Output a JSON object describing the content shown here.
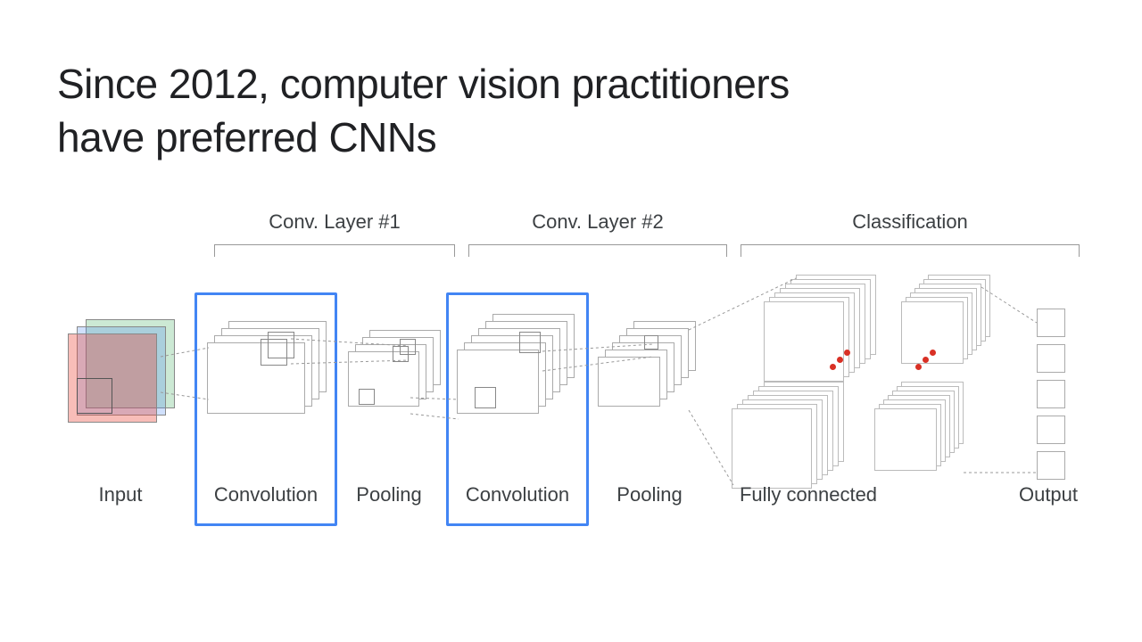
{
  "title_line1": "Since 2012, computer vision practitioners",
  "title_line2": "have preferred CNNs",
  "sections": {
    "conv1": "Conv. Layer #1",
    "conv2": "Conv. Layer #2",
    "classification": "Classification"
  },
  "stages": {
    "input": "Input",
    "convolution": "Convolution",
    "pooling": "Pooling",
    "fully_connected": "Fully connected",
    "output": "Output"
  },
  "highlighted_stages": [
    "convolution_1",
    "convolution_2"
  ],
  "dot_color": "#d93025",
  "highlight_color": "#4285f4"
}
